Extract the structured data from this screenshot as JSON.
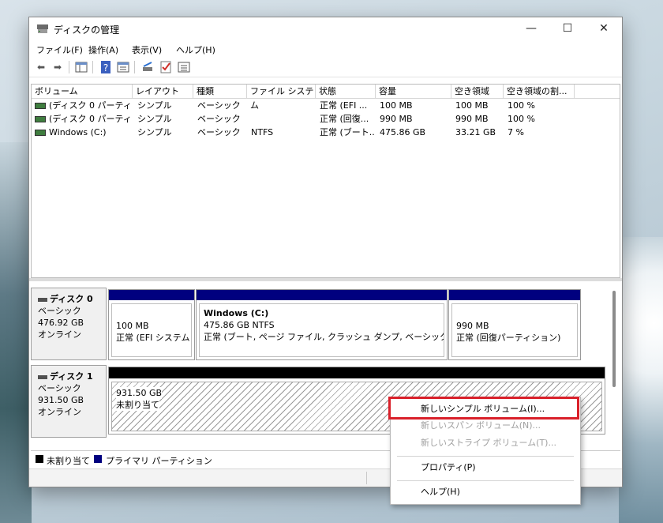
{
  "window": {
    "title": "ディスクの管理"
  },
  "menu": [
    "ファイル(F)",
    "操作(A)",
    "表示(V)",
    "ヘルプ(H)"
  ],
  "toolbar_icons": [
    "back-arrow-icon",
    "forward-arrow-icon",
    "console-tree-icon",
    "help-icon",
    "properties-icon",
    "connect-icon",
    "check-icon",
    "list-icon"
  ],
  "volume_table": {
    "columns": [
      "ボリューム",
      "レイアウト",
      "種類",
      "ファイル システム",
      "状態",
      "容量",
      "空き領域",
      "空き領域の割..."
    ],
    "rows": [
      [
        "(ディスク 0 パーティシ...",
        "シンプル",
        "ベーシック",
        "",
        "正常 (EFI ...",
        "100 MB",
        "100 MB",
        "100 %"
      ],
      [
        "(ディスク 0 パーティシ...",
        "シンプル",
        "ベーシック",
        "",
        "正常 (回復...",
        "990 MB",
        "990 MB",
        "100 %"
      ],
      [
        "Windows (C:)",
        "シンプル",
        "ベーシック",
        "NTFS",
        "正常 (ブート...",
        "475.86 GB",
        "33.21 GB",
        "7 %"
      ]
    ]
  },
  "disk0": {
    "title": "ディスク 0",
    "type": "ベーシック",
    "size": "476.92 GB",
    "status": "オンライン",
    "partitions": [
      {
        "name": "",
        "size": "100 MB",
        "status": "正常 (EFI システム パ"
      },
      {
        "name": "Windows  (C:)",
        "size": "475.86 GB NTFS",
        "status": "正常 (ブート, ページ ファイル, クラッシュ ダンプ, ベーシック データ パー"
      },
      {
        "name": "",
        "size": "990 MB",
        "status": "正常 (回復パーティション)"
      }
    ]
  },
  "disk1": {
    "title": "ディスク 1",
    "type": "ベーシック",
    "size": "931.50 GB",
    "status": "オンライン",
    "unallocated": {
      "size": "931.50 GB",
      "label": "未割り当て"
    }
  },
  "legend": [
    {
      "label": "未割り当て",
      "color": "#000000"
    },
    {
      "label": "プライマリ パーティション",
      "color": "#00007f"
    }
  ],
  "context_menu": {
    "new_simple": "新しいシンプル ボリューム(I)...",
    "new_spanned": "新しいスパン ボリューム(N)...",
    "new_striped": "新しいストライプ ボリューム(T)...",
    "properties": "プロパティ(P)",
    "help": "ヘルプ(H)"
  },
  "highlight_color": "#d9202a"
}
